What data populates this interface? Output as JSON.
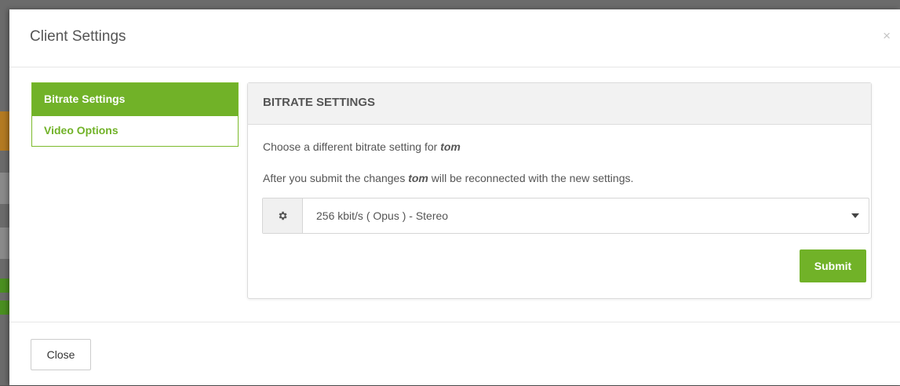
{
  "modal": {
    "title": "Client Settings",
    "close_glyph": "×"
  },
  "sidebar": {
    "items": [
      {
        "label": "Bitrate Settings",
        "active": true
      },
      {
        "label": "Video Options",
        "active": false
      }
    ]
  },
  "panel": {
    "heading": "BITRATE SETTINGS",
    "line1_prefix": "Choose a different bitrate setting for ",
    "line1_user": "tom",
    "line2_prefix": "After you submit the changes ",
    "line2_user": "tom",
    "line2_suffix": " will be reconnected with the new settings.",
    "select_icon": "gear-icon",
    "select_value": "256 kbit/s ( Opus ) - Stereo",
    "submit_label": "Submit"
  },
  "footer": {
    "close_label": "Close"
  },
  "colors": {
    "accent": "#71b228",
    "text": "#555555"
  }
}
